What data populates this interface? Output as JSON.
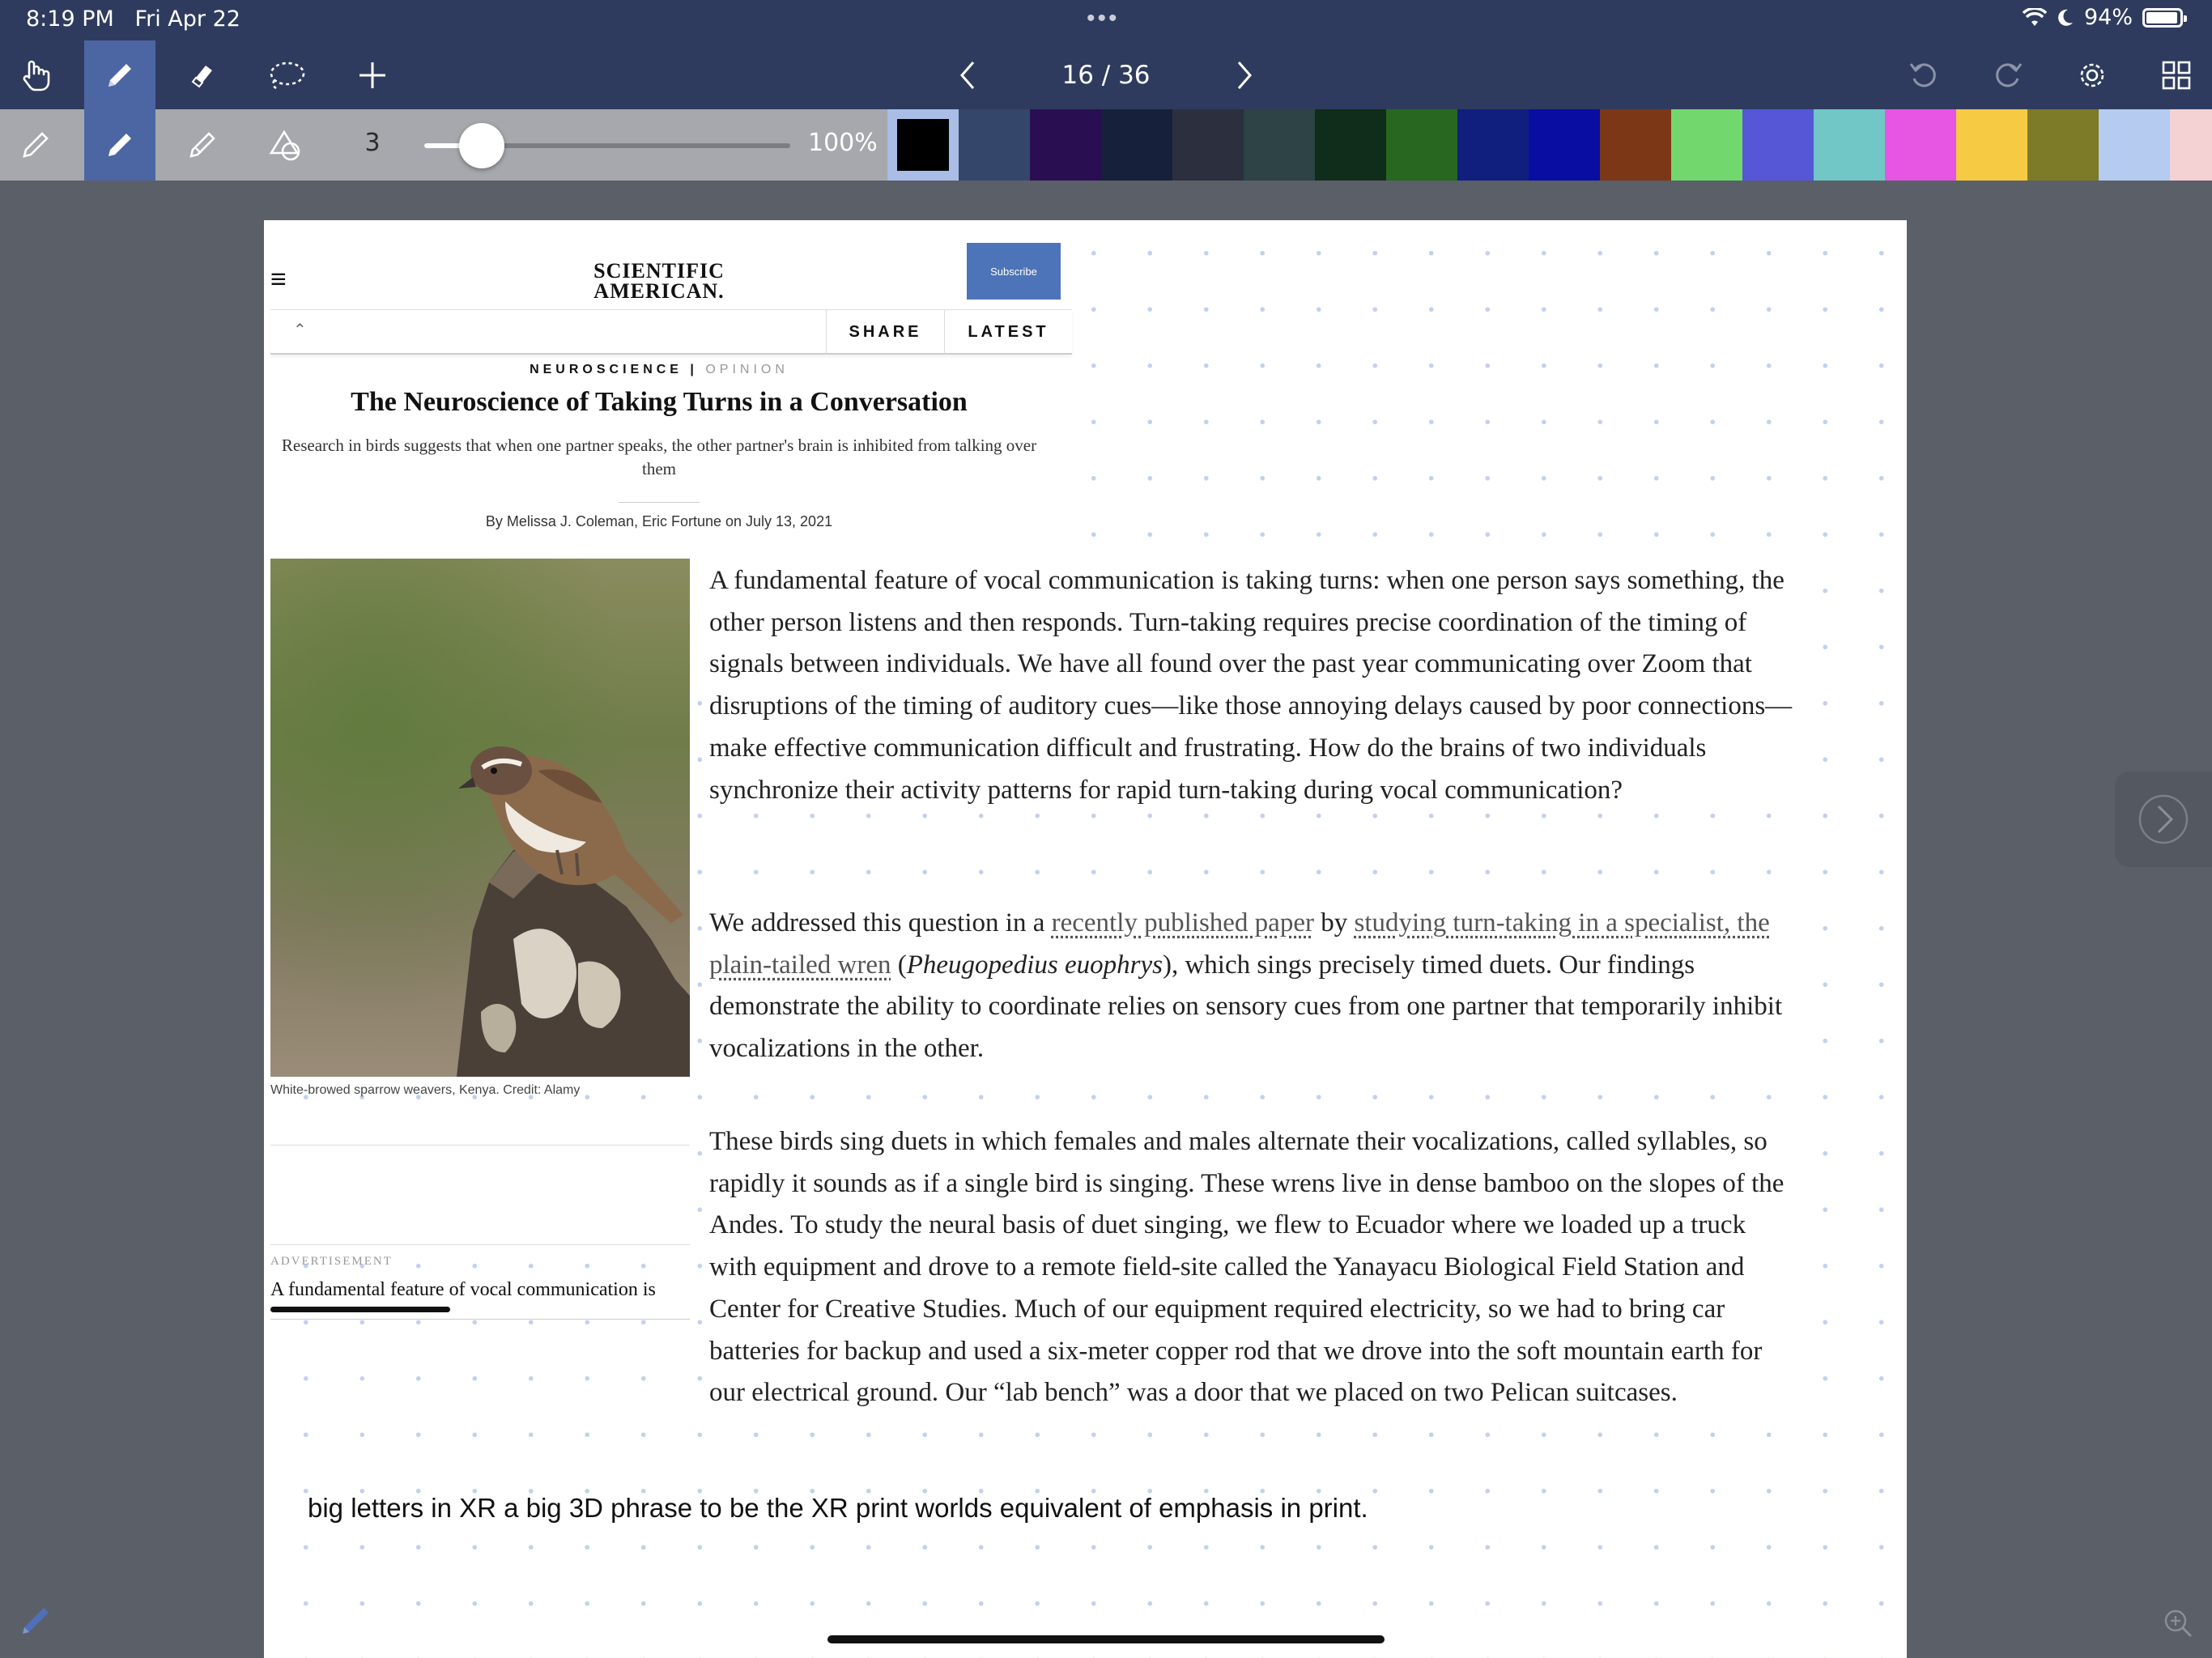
{
  "status_bar": {
    "time": "8:19 PM",
    "date": "Fri Apr 22",
    "battery": "94%",
    "battery_level": 0.94
  },
  "toolbar": {
    "page_counter": "16 / 36",
    "tools": [
      "hand-tool",
      "pen-tool",
      "eraser-tool",
      "lasso-tool",
      "add-tool"
    ],
    "active_tool": "pen-tool",
    "right_tools": [
      "undo",
      "redo",
      "settings",
      "grid-view"
    ]
  },
  "pen_bar": {
    "pen_types": [
      "fountain-pen",
      "ballpoint-pen",
      "brush-pen",
      "shapes"
    ],
    "active_pen": "ballpoint-pen",
    "stroke_size": "3",
    "slider_level": 0.14,
    "opacity": "100%",
    "colors": [
      "#000000",
      "#34466a",
      "#2a0e52",
      "#16203a",
      "#2c2f3e",
      "#2d4346",
      "#102c1a",
      "#27671f",
      "#101f7d",
      "#090da2",
      "#7b3716",
      "#72d86d",
      "#5557d6",
      "#71c6c6",
      "#e755e3",
      "#f6ca43",
      "#7d7a28",
      "#b5cbef",
      "#f4d2d4"
    ],
    "selected_color": "#000000"
  },
  "article": {
    "logo_line1": "SCIENTIFIC",
    "logo_line2": "AMERICAN.",
    "subscribe": "Subscribe",
    "share": "SHARE",
    "latest": "LATEST",
    "kicker_section": "NEUROSCIENCE",
    "kicker_sep": "|",
    "kicker_type": "OPINION",
    "headline": "The Neuroscience of Taking Turns in a Conversation",
    "dek": "Research in birds suggests that when one partner speaks, the other partner's brain is inhibited from talking over them",
    "byline": "By Melissa J. Coleman, Eric Fortune on July 13, 2021",
    "caption": "White-browed sparrow weavers, Kenya. Credit: Alamy",
    "ad_label": "ADVERTISEMENT",
    "snippet": "A fundamental feature of vocal communication is",
    "p1": "A fundamental feature of vocal communication is taking turns: when one person says something, the other person listens and then responds. Turn-taking requires precise coordination of the timing of signals between individuals. We have all found over the past year communicating over Zoom that disruptions of the timing of auditory cues—like those annoying delays caused by poor connections—make effective communication difficult and frustrating. How do the brains of two individuals synchronize their activity patterns for rapid turn-taking during vocal communication?",
    "p2_a": "We addressed this question in a ",
    "p2_link1": "recently published paper",
    "p2_b": " by ",
    "p2_link2": "studying turn-taking in a specialist, the plain-tailed wren",
    "p2_c": " (",
    "p2_species": "Pheugopedius euophrys",
    "p2_d": "), which sings precisely timed duets. Our findings demonstrate the ability to coordinate relies on sensory cues from one partner that temporarily inhibit vocalizations in the other.",
    "p3": "These birds sing duets in which females and males alternate their vocalizations, called syllables, so rapidly it sounds as if a single bird is singing. These wrens live in dense bamboo on the slopes of the Andes. To study the neural basis of duet singing, we flew to Ecuador where we loaded up a truck with equipment and drove to a remote field-site called the Yanayacu Biological Field Station and Center for Creative Studies. Much of our equipment required electricity, so we had to bring car batteries for backup and used a six-meter copper rod that we drove into the soft mountain earth for our electrical ground. Our “lab bench” was a door that we placed on two Pelican suitcases."
  },
  "typed_note": "big letters in XR a big 3D phrase to be the XR print worlds equivalent of emphasis in print."
}
